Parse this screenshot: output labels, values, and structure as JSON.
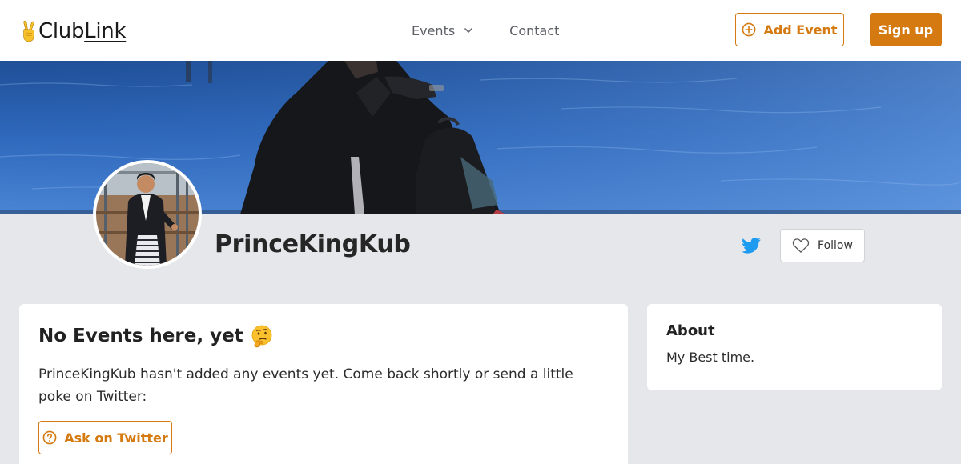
{
  "header": {
    "logo_prefix": "Club",
    "logo_suffix": "Link",
    "nav": {
      "events_label": "Events",
      "contact_label": "Contact"
    },
    "add_event_label": "Add Event",
    "signup_label": "Sign up"
  },
  "profile": {
    "name": "PrinceKingKub",
    "follow_label": "Follow"
  },
  "events_card": {
    "title": "No Events here, yet",
    "emoji": "thinking-face",
    "message": "PrinceKingKub hasn't added any events yet. Come back shortly or send a little poke on Twitter:",
    "ask_button_label": "Ask on Twitter"
  },
  "about_card": {
    "title": "About",
    "text": "My Best time."
  },
  "colors": {
    "accent": "#d57a10",
    "page_background": "#e6e7ea",
    "twitter_blue": "#1d9bf0",
    "nav_text": "#5d6067"
  },
  "icons": {
    "logo": "victory-hand-icon",
    "events_dropdown": "chevron-down-icon",
    "add_event": "plus-circle-icon",
    "twitter": "twitter-bird-icon",
    "follow": "heart-icon",
    "ask": "question-circle-icon"
  }
}
